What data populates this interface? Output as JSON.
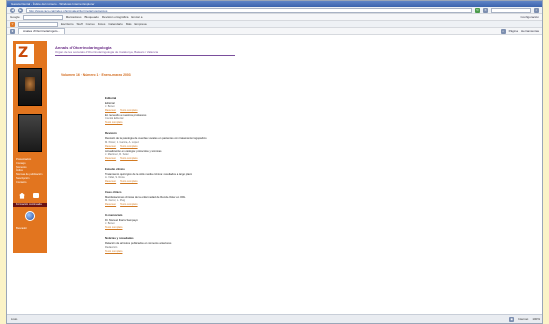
{
  "window": {
    "title": "Gaceta Dental - Índice del número - Windows Internet Explorer"
  },
  "toolbar": {
    "address": "http://www.raco.cat/index.php/AnalesOtorrinolaringologicos",
    "search_label": "Google",
    "menu_items": [
      "Marcadores",
      "Bloqueado",
      "Revisión ortográfica",
      "Enviar a"
    ],
    "links_label": "Vínculos",
    "favorites_label": "Favoritos",
    "configuracion_label": "Configuración",
    "tab_label": "Anales d'Otorrinolaringolo...",
    "page_menu": "Página",
    "tools_menu": "Herramientas",
    "bar2_items": [
      "Escritorio",
      "Stuff",
      "Correo",
      "Fotos",
      "Calendario",
      "Más",
      "Empresa"
    ]
  },
  "sidebar": {
    "logo_letter": "Z",
    "menu": [
      "Presentación",
      "Consejo",
      "Números",
      "Índice",
      "Normas de publicación",
      "Suscripción",
      "Contacto"
    ],
    "band_label": "Formación continuada",
    "footer_label": "Buscador"
  },
  "header": {
    "title": "Annals d'Otorrinolaringologia",
    "subtitle": "Organ de les societats d'Otorrinolaringologia de Catalunya, Balears i València"
  },
  "volume": "Volumen 16 · Número 1 · Enero-marzo 2003",
  "toc": [
    {
      "section": "Editorial",
      "articles": [
        {
          "title": "Editorial",
          "authors": "J. Bonet",
          "links": [
            "Resumen",
            "Texto completo"
          ]
        }
      ]
    },
    {
      "section": "",
      "articles": [
        {
          "title": "En recuerdo a nuestros profesores",
          "authors": "Comité Editorial",
          "links": [
            "Texto completo"
          ]
        }
      ]
    },
    {
      "section": "Revisión",
      "articles": [
        {
          "title": "Revisión de la patología de cuerdas vocales en pacientes con tratamiento logopédico",
          "authors": "M. Pérez, J. García, A. López",
          "links": [
            "Resumen",
            "Texto completo"
          ]
        },
        {
          "title": "Actualización en otología: protocolos y técnicas",
          "authors": "J. Martínez, R. Soler",
          "links": [
            "Resumen",
            "Texto completo"
          ]
        }
      ]
    },
    {
      "section": "Estudio clínico",
      "articles": [
        {
          "title": "Tratamiento quirúrgico de la otitis media crónica: resultados a largo plazo",
          "authors": "A. Vidal, S. Roca",
          "links": [
            "Resumen",
            "Texto completo"
          ]
        }
      ]
    },
    {
      "section": "Caso clínico",
      "articles": [
        {
          "title": "Manifestaciones clínicas de la enfermedad de Rendu-Osler en ORL",
          "authors": "M. Ferrer, L. Puig",
          "links": [
            "Resumen",
            "Texto completo"
          ]
        }
      ]
    },
    {
      "section": "In memoriam",
      "articles": [
        {
          "title": "Dr. Manuel Ibarra Sampayo",
          "authors": "J. Bonet",
          "links": [
            "Texto completo"
          ]
        }
      ]
    },
    {
      "section": "Noticias y novedades",
      "articles": [
        {
          "title": "Relación de artículos publicados en números anteriores",
          "authors": "Redacción",
          "links": [
            "Texto completo"
          ]
        }
      ]
    }
  ],
  "status": {
    "left": "Listo",
    "zone": "Internet",
    "zoom": "100%"
  }
}
